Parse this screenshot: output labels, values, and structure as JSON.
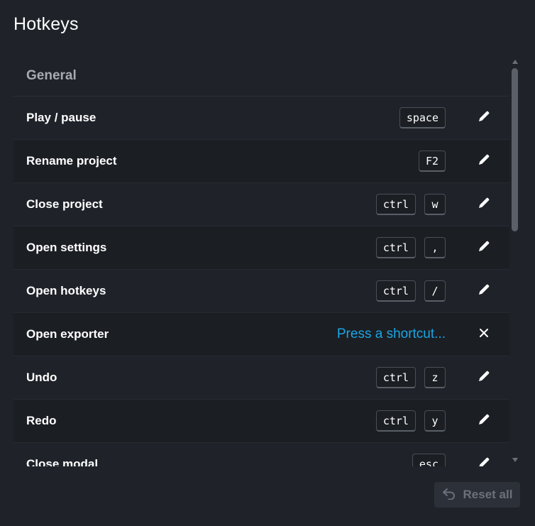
{
  "title": "Hotkeys",
  "section": {
    "label": "General"
  },
  "rows": [
    {
      "label": "Play / pause",
      "keys": [
        "space"
      ],
      "action": "edit"
    },
    {
      "label": "Rename project",
      "keys": [
        "F2"
      ],
      "action": "edit"
    },
    {
      "label": "Close project",
      "keys": [
        "ctrl",
        "w"
      ],
      "action": "edit"
    },
    {
      "label": "Open settings",
      "keys": [
        "ctrl",
        ","
      ],
      "action": "edit"
    },
    {
      "label": "Open hotkeys",
      "keys": [
        "ctrl",
        "/"
      ],
      "action": "edit"
    },
    {
      "label": "Open exporter",
      "keys": [],
      "prompt": "Press a shortcut...",
      "action": "cancel"
    },
    {
      "label": "Undo",
      "keys": [
        "ctrl",
        "z"
      ],
      "action": "edit"
    },
    {
      "label": "Redo",
      "keys": [
        "ctrl",
        "y"
      ],
      "action": "edit"
    },
    {
      "label": "Close modal",
      "keys": [
        "esc"
      ],
      "action": "edit"
    }
  ],
  "reset_button": {
    "label": "Reset all",
    "icon": "undo-arrow-icon"
  },
  "icons": {
    "edit": "pencil-icon",
    "cancel": "close-icon"
  },
  "colors": {
    "accent": "#1aa6e4",
    "background": "#1f2329",
    "row_alt": "#1b1e23"
  }
}
